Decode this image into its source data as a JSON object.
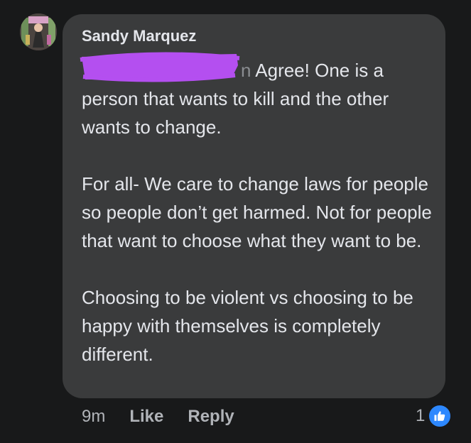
{
  "comment": {
    "author": "Sandy Marquez",
    "redacted_mention_tail": "n",
    "paragraphs": [
      "Agree! One is a person that wants to kill and the other wants to change.",
      "For all- We care to change laws for people so people don’t get harmed. Not for people that want to choose what they want to be.",
      "Choosing to be violent vs choosing to be happy with themselves is completely different."
    ],
    "timestamp": "9m",
    "like_label": "Like",
    "reply_label": "Reply",
    "reaction_count": "1",
    "reaction_icon": "thumbs-up-icon"
  },
  "colors": {
    "background": "#18191a",
    "bubble": "#3a3b3c",
    "text": "#e4e6eb",
    "secondary_text": "#b0b3b8",
    "like_blue": "#2d88ff",
    "redaction": "#b44ff0"
  }
}
